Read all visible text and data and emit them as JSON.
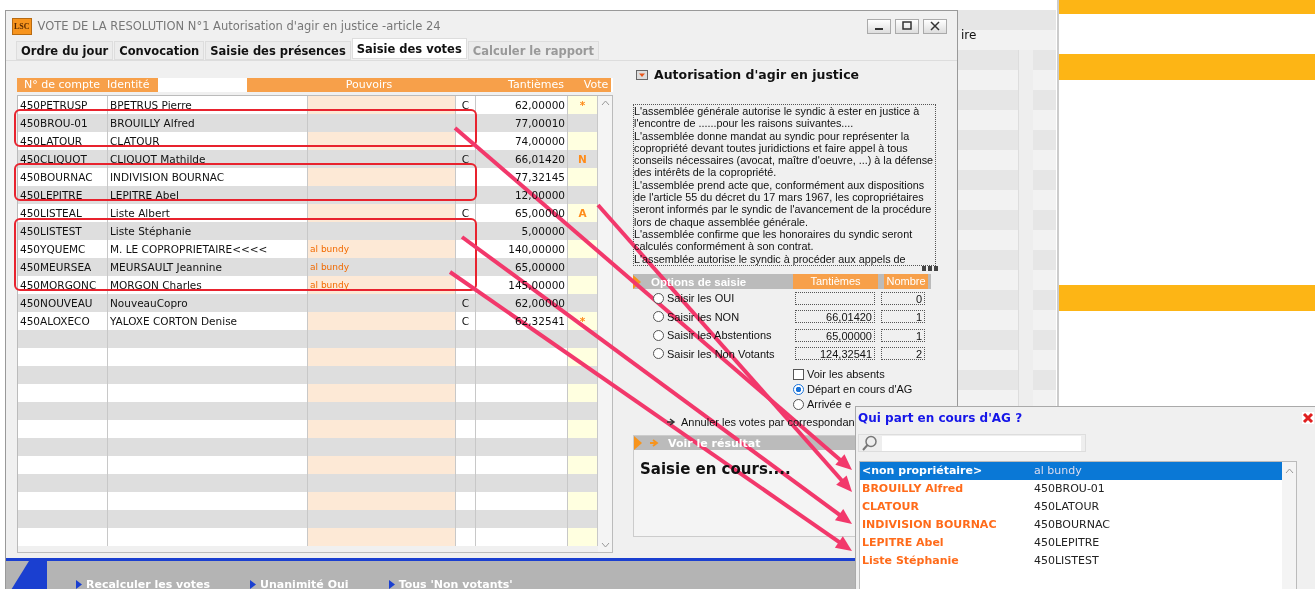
{
  "window": {
    "badge": "LSC",
    "title": "VOTE DE LA RESOLUTION N°1 Autorisation d'agir en justice -article 24"
  },
  "tabs": [
    {
      "label": "Ordre du jour",
      "selected": false,
      "disabled": false
    },
    {
      "label": "Convocation",
      "selected": false,
      "disabled": false
    },
    {
      "label": "Saisie des présences",
      "selected": false,
      "disabled": false
    },
    {
      "label": "Saisie des votes",
      "selected": true,
      "disabled": false
    },
    {
      "label": "Calculer le rapport",
      "selected": false,
      "disabled": true
    }
  ],
  "table": {
    "columns": [
      "N° de compte",
      "Identité",
      "Pouvoirs",
      "Tantièmes",
      "Vote"
    ],
    "rows": [
      {
        "account": "450PETRUSP",
        "identity": "BPETRUS Pierre",
        "flag": "C",
        "tantiemes": "62,00000",
        "vote": "*"
      },
      {
        "account": "450BROU-01",
        "identity": "BROUILLY Alfred",
        "tantiemes": "77,00010"
      },
      {
        "account": "450LATOUR",
        "identity": "CLATOUR",
        "tantiemes": "74,00000"
      },
      {
        "account": "450CLIQUOT",
        "identity": "CLIQUOT Mathilde",
        "flag": "C",
        "tantiemes": "66,01420",
        "vote": "N"
      },
      {
        "account": "450BOURNAC",
        "identity": "INDIVISION BOURNAC",
        "tantiemes": "77,32145"
      },
      {
        "account": "450LEPITRE",
        "identity": "LEPITRE Abel",
        "tantiemes": "12,00000"
      },
      {
        "account": "450LISTEAL",
        "identity": "Liste Albert",
        "flag": "C",
        "tantiemes": "65,00000",
        "vote": "A"
      },
      {
        "account": "450LISTEST",
        "identity": "Liste Stéphanie",
        "tantiemes": "5,00000"
      },
      {
        "account": "450YQUEMC",
        "identity": "M. LE COPROPRIETAIRE<<<<",
        "proxy": "al bundy",
        "tantiemes": "140,00000"
      },
      {
        "account": "450MEURSEA",
        "identity": "MEURSAULT Jeannine",
        "proxy": "al bundy",
        "tantiemes": "65,00000"
      },
      {
        "account": "450MORGONC",
        "identity": "MORGON Charles",
        "proxy": "al bundy",
        "tantiemes": "145,00000"
      },
      {
        "account": "450NOUVEAU",
        "identity": "NouveauCopro",
        "flag": "C",
        "tantiemes": "62,00000"
      },
      {
        "account": "450ALOXECO",
        "identity": "YALOXE CORTON Denise",
        "flag": "C",
        "tantiemes": "62,32541",
        "vote": "*"
      }
    ]
  },
  "resolution": {
    "title": "Autorisation d'agir en justice",
    "paragraphs": [
      "L'assemblée générale autorise le syndic à ester en justice à l'encontre de ......pour les raisons suivantes....",
      "L'assemblée donne mandat au syndic pour représenter la copropriété devant toutes juridictions et faire appel à tous conseils nécessaires (avocat, maître d'oeuvre, ...) à la défense des intérêts de la copropriété.",
      "L'assemblée prend acte que, conformément aux dispositions de l'article 55 du décret du 17 mars 1967, les copropriétaires seront informés par le syndic de l'avancement de la procédure lors de chaque assemblée générale.",
      "L'assemblée confirme que les honoraires du syndic seront calculés conformément à son contrat.",
      "L'assemblée autorise le syndic à procéder aux appels de"
    ]
  },
  "options": {
    "title": "Options de saisie",
    "columns": [
      "Tantièmes",
      "Nombre"
    ],
    "choices": [
      {
        "label": "Saisir les OUI",
        "selected": false,
        "count": "0"
      },
      {
        "label": "Saisir les NON",
        "selected": false,
        "tantiemes": "66,01420",
        "count": "1"
      },
      {
        "label": "Saisir les Abstentions",
        "selected": false,
        "tantiemes": "65,00000",
        "count": "1"
      },
      {
        "label": "Saisir les Non Votants",
        "selected": false,
        "tantiemes": "124,32541",
        "count": "2"
      }
    ],
    "show_absent": {
      "label": "Voir les absents",
      "checked": false
    },
    "movements": [
      {
        "label": "Départ en cours d'AG",
        "selected": true
      },
      {
        "label": "Arrivée e",
        "selected": false
      }
    ],
    "cancel_link": "Annuler les votes par correspondan"
  },
  "result": {
    "title": "Voir le résultat",
    "status": "Saisie en cours...."
  },
  "actions": [
    "Recalculer les votes",
    "Unanimité Oui",
    "Tous 'Non votants'"
  ],
  "background_window": {
    "text": "ire"
  },
  "popup": {
    "title": "Qui part en cours d'AG ?",
    "rows": [
      {
        "name": "<non propriétaire>",
        "code": "al bundy",
        "selected": true
      },
      {
        "name": "BROUILLY Alfred",
        "code": "450BROU-01",
        "selected": false
      },
      {
        "name": "CLATOUR",
        "code": "450LATOUR",
        "selected": false
      },
      {
        "name": "INDIVISION BOURNAC",
        "code": "450BOURNAC",
        "selected": false
      },
      {
        "name": "LEPITRE Abel",
        "code": "450LEPITRE",
        "selected": false
      },
      {
        "name": "Liste Stéphanie",
        "code": "450LISTEST",
        "selected": false
      }
    ]
  }
}
